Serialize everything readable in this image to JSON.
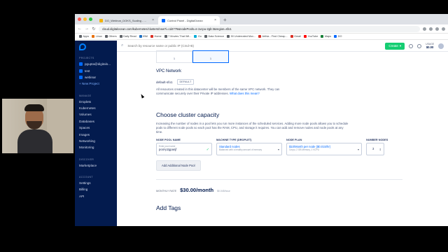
{
  "browser": {
    "tabs": [
      {
        "title": "DO_Webinar_DOKS_Scaling - ...",
        "active": false,
        "favicon_color": "#f4b400"
      },
      {
        "title": "Control Panel - DigitalOcean",
        "active": true,
        "favicon_color": "#0069ff"
      }
    ],
    "new_tab": "+",
    "url": "cloud.digitalocean.com/kubernetes/clusters/new?i=cd4779&nodePools=s-1vcpu-2gb:3&region=sfo1",
    "nav": {
      "back": "←",
      "forward": "→",
      "reload": "↻"
    },
    "bookmarks": [
      {
        "label": "Apps",
        "color": "#5f6368"
      },
      {
        "label": "Linux",
        "color": "#e8710a"
      },
      {
        "label": "Others",
        "color": "#5f6368"
      },
      {
        "label": "Daily Read",
        "color": "#5f6368"
      },
      {
        "label": "IBM",
        "color": "#1f70c1"
      },
      {
        "label": "Home",
        "color": "#d93025"
      },
      {
        "label": "7 Movies That Wil...",
        "color": "#5f6368"
      },
      {
        "label": "Go",
        "color": "#00add8"
      },
      {
        "label": "Data Science",
        "color": "#5f6368"
      },
      {
        "label": "50 Underrated Mov...",
        "color": "#5f6368"
      },
      {
        "label": "Arthia - Find Cheap...",
        "color": "#d93025"
      },
      {
        "label": "Gmail",
        "color": "#d93025"
      },
      {
        "label": "YouTube",
        "color": "#ff0000"
      },
      {
        "label": "Maps",
        "color": "#188038"
      },
      {
        "label": "DO",
        "color": "#0069ff"
      }
    ]
  },
  "sidebar": {
    "projects_heading": "PROJECTS",
    "projects": [
      "pgupta@digitalo...",
      "test",
      "webinar"
    ],
    "new_project": "+ New Project",
    "manage_heading": "MANAGE",
    "manage_items": [
      "Droplets",
      "Kubernetes",
      "Volumes",
      "Databases",
      "Spaces",
      "Images",
      "Networking",
      "Monitoring"
    ],
    "discover_heading": "DISCOVER",
    "discover_items": [
      "Marketplace"
    ],
    "account_heading": "ACCOUNT",
    "account_items": [
      "Settings",
      "Billing",
      "API"
    ]
  },
  "topbar": {
    "search_placeholder": "Search by resource name or public IP (Cmd+B)",
    "create_label": "Create",
    "usage_label": "USAGE",
    "usage_value": "$0.00"
  },
  "datacenter": {
    "cells": [
      "1",
      "1"
    ]
  },
  "vpc": {
    "heading": "VPC Network",
    "name": "default-sfo1",
    "tag": "DEFAULT",
    "description": "All resources created in this datacenter will be members of the same VPC network. They can communicate securely over their Private IP addresses.",
    "link": "What does this mean?"
  },
  "capacity": {
    "heading": "Choose cluster capacity",
    "description": "Increasing the number of nodes in a pool lets you run more instances of the scheduled services. Adding more node pools allows you to schedule pods to different node pools so each pool has the RAM, CPU, and storage it requires. You can add and remove nodes and node pools at any time.",
    "columns": {
      "pool_name": "NODE POOL NAME",
      "machine_type": "MACHINE TYPE (DROPLET)",
      "node_plan": "NODE PLAN",
      "number_nodes": "NUMBER NODES"
    },
    "pool": {
      "name_label": "Enter pool name",
      "name_value": "pool-p2gpanjf",
      "machine_type": "Standard nodes",
      "machine_sub": "Balanced with a healthy amount of memory",
      "plan": "$10/Month per node ($0.015/hr)",
      "plan_sub": "1vcpu, 2 GB Memory, 1 VCPU",
      "nodes": "3"
    },
    "add_pool_label": "Add Additional Node Pool"
  },
  "rate": {
    "label": "MONTHLY RATE",
    "price": "$30.00/month",
    "hourly": "$0.045/hour"
  },
  "tags": {
    "heading": "Add Tags"
  },
  "colors": {
    "sidebar": "#031b4e",
    "accent": "#0069ff",
    "create": "#15cd72"
  }
}
